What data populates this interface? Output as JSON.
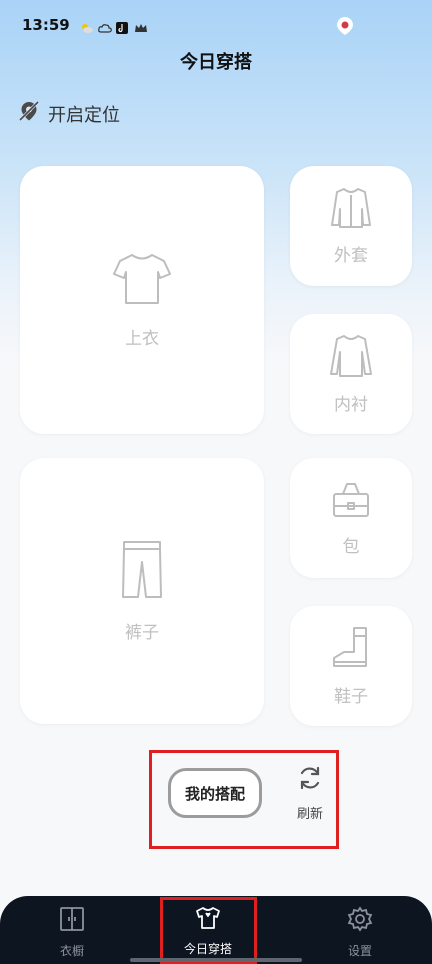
{
  "status_bar": {
    "time": "13:59"
  },
  "header": {
    "title": "今日穿搭"
  },
  "location": {
    "label": "开启定位"
  },
  "cards": {
    "top": "上衣",
    "pants": "裤子",
    "coat": "外套",
    "inner": "内衬",
    "bag": "包",
    "shoes": "鞋子"
  },
  "actions": {
    "my_match": "我的搭配",
    "refresh": "刷新"
  },
  "tabbar": {
    "wardrobe": "衣橱",
    "today": "今日穿搭",
    "settings": "设置"
  },
  "colors": {
    "accent_highlight": "#e02020",
    "tabbar_bg": "#0d1520",
    "card_label": "#c0c0c0"
  }
}
